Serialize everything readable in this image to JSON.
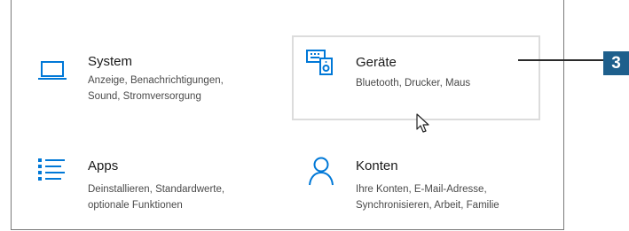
{
  "tiles": [
    {
      "title": "System",
      "desc_lines": [
        "Anzeige, Benachrichtigungen,",
        "Sound, Stromversorgung"
      ],
      "icon": "laptop-icon"
    },
    {
      "title": "Geräte",
      "desc_lines": [
        "Bluetooth, Drucker, Maus"
      ],
      "icon": "devices-icon"
    },
    {
      "title": "Apps",
      "desc_lines": [
        "Deinstallieren, Standardwerte,",
        "optionale Funktionen"
      ],
      "icon": "apps-list-icon"
    },
    {
      "title": "Konten",
      "desc_lines": [
        "Ihre Konten, E-Mail-Adresse,",
        "Synchronisieren, Arbeit, Familie"
      ],
      "icon": "person-icon"
    }
  ],
  "callout": {
    "label": "3"
  },
  "colors": {
    "accent": "#0078d7",
    "badge": "#1e5f8c"
  }
}
